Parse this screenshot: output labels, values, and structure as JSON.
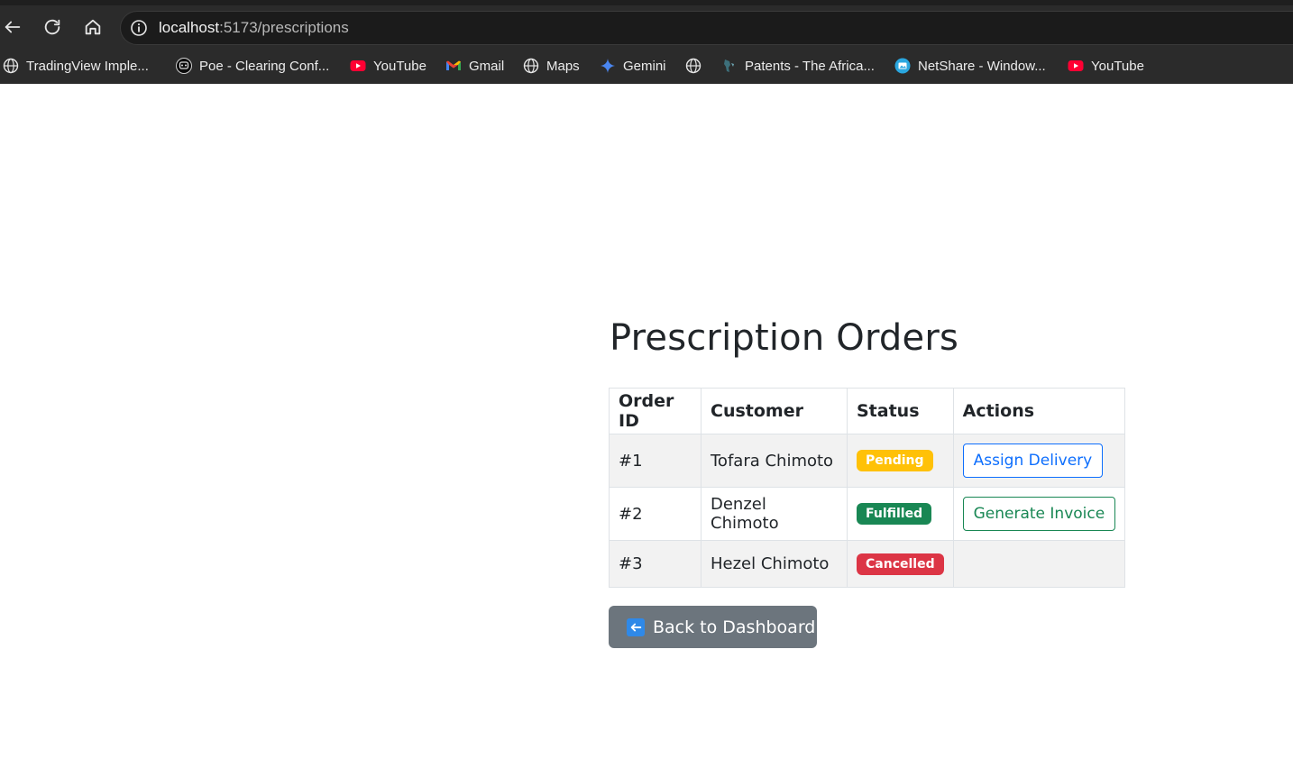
{
  "browser": {
    "url_host": "localhost",
    "url_path": ":5173/prescriptions",
    "bookmarks": [
      {
        "label": "TradingView Imple...",
        "icon": "globe-icon"
      },
      {
        "label": "Poe - Clearing Conf...",
        "icon": "poe-icon"
      },
      {
        "label": "YouTube",
        "icon": "youtube-icon"
      },
      {
        "label": "Gmail",
        "icon": "gmail-icon"
      },
      {
        "label": "Maps",
        "icon": "globe-icon"
      },
      {
        "label": "Gemini",
        "icon": "gemini-icon"
      },
      {
        "label": "",
        "icon": "globe-icon"
      },
      {
        "label": "Patents - The Africa...",
        "icon": "patents-icon"
      },
      {
        "label": "NetShare - Window...",
        "icon": "netshare-icon"
      },
      {
        "label": "YouTube",
        "icon": "youtube-icon"
      }
    ]
  },
  "page": {
    "title": "Prescription Orders",
    "table": {
      "headers": [
        "Order ID",
        "Customer",
        "Status",
        "Actions"
      ],
      "rows": [
        {
          "id": "#1",
          "customer": "Tofara Chimoto",
          "status": "Pending",
          "action": "Assign Delivery"
        },
        {
          "id": "#2",
          "customer": "Denzel Chimoto",
          "status": "Fulfilled",
          "action": "Generate Invoice"
        },
        {
          "id": "#3",
          "customer": "Hezel Chimoto",
          "status": "Cancelled",
          "action": ""
        }
      ]
    },
    "back_button": "Back to Dashboard"
  },
  "colors": {
    "pending": "#ffc107",
    "fulfilled": "#198754",
    "cancelled": "#dc3545",
    "primary": "#0d6efd",
    "secondary": "#6c757d"
  }
}
